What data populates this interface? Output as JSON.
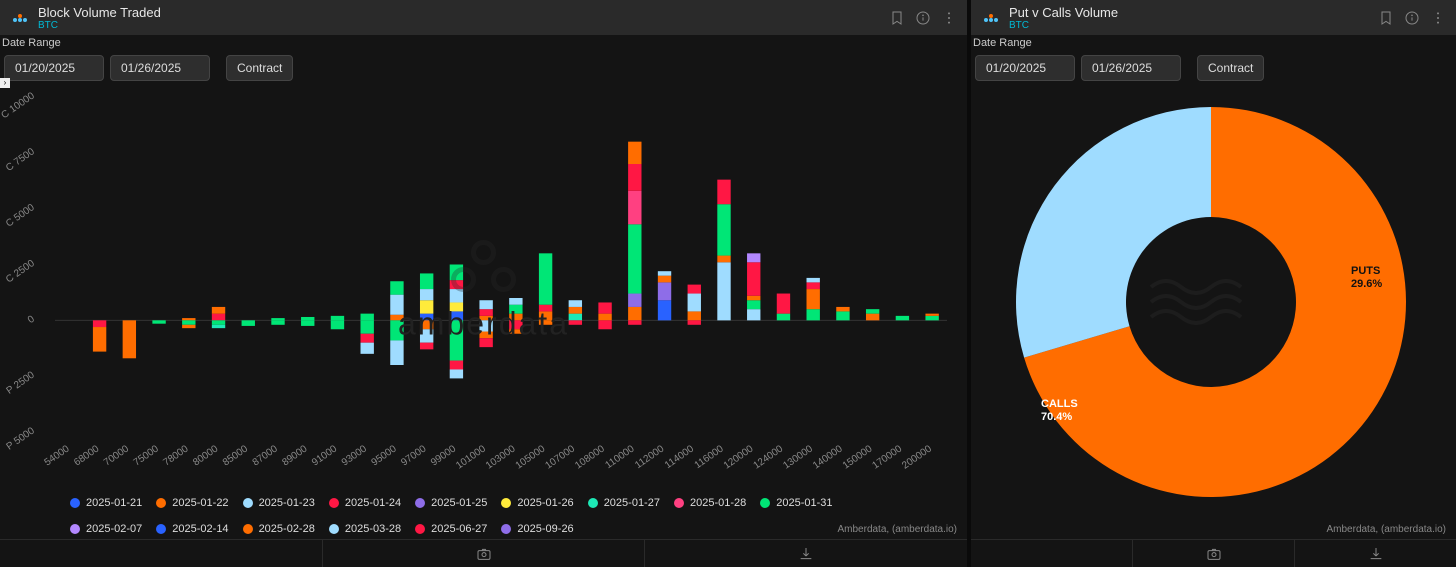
{
  "left": {
    "title": "Block Volume Traded",
    "subtitle": "BTC",
    "date_range_label": "Date Range",
    "date_from": "01/20/2025",
    "date_to": "01/26/2025",
    "contract_btn": "Contract",
    "attribution": "Amberdata, (amberdata.io)",
    "watermark": "amberdata"
  },
  "right": {
    "title": "Put v Calls Volume",
    "subtitle": "BTC",
    "date_range_label": "Date Range",
    "date_from": "01/20/2025",
    "date_to": "01/26/2025",
    "contract_btn": "Contract",
    "attribution": "Amberdata, (amberdata.io)"
  },
  "legend_items": [
    {
      "label": "2025-01-21",
      "color": "#2962ff"
    },
    {
      "label": "2025-01-22",
      "color": "#ff6d00"
    },
    {
      "label": "2025-01-23",
      "color": "#9fdcff"
    },
    {
      "label": "2025-01-24",
      "color": "#ff1744"
    },
    {
      "label": "2025-01-25",
      "color": "#8e6de8"
    },
    {
      "label": "2025-01-26",
      "color": "#ffeb3b"
    },
    {
      "label": "2025-01-27",
      "color": "#1de9b6"
    },
    {
      "label": "2025-01-28",
      "color": "#ff4081"
    },
    {
      "label": "2025-01-31",
      "color": "#00e676"
    },
    {
      "label": "2025-02-07",
      "color": "#b388ff"
    },
    {
      "label": "2025-02-14",
      "color": "#2962ff"
    },
    {
      "label": "2025-02-28",
      "color": "#ff6d00"
    },
    {
      "label": "2025-03-28",
      "color": "#9fdcff"
    },
    {
      "label": "2025-06-27",
      "color": "#ff1744"
    },
    {
      "label": "2025-09-26",
      "color": "#8e6de8"
    }
  ],
  "chart_data": [
    {
      "type": "bar",
      "title": "Block Volume Traded (BTC)",
      "orientation": "diverging",
      "ylabel_pos": "C",
      "ylabel_neg": "P",
      "ylim": [
        -5000,
        10000
      ],
      "y_ticks": [
        -5000,
        -2500,
        0,
        2500,
        5000,
        7500,
        10000
      ],
      "y_tick_labels": [
        "P 5000",
        "P 2500",
        "0",
        "C 2500",
        "C 5000",
        "C 7500",
        "C 10000"
      ],
      "categories": [
        "54000",
        "68000",
        "70000",
        "75000",
        "78000",
        "80000",
        "85000",
        "87000",
        "89000",
        "91000",
        "93000",
        "95000",
        "97000",
        "99000",
        "101000",
        "103000",
        "105000",
        "107000",
        "108000",
        "110000",
        "112000",
        "114000",
        "116000",
        "120000",
        "124000",
        "130000",
        "140000",
        "150000",
        "170000",
        "200000"
      ],
      "series_colors": {
        "2025-01-21": "#2962ff",
        "2025-01-22": "#ff6d00",
        "2025-01-23": "#9fdcff",
        "2025-01-24": "#ff1744",
        "2025-01-25": "#8e6de8",
        "2025-01-26": "#ffeb3b",
        "2025-01-27": "#1de9b6",
        "2025-01-28": "#ff4081",
        "2025-01-31": "#00e676",
        "2025-02-07": "#b388ff",
        "2025-02-14": "#2962ff",
        "2025-02-28": "#ff6d00",
        "2025-03-28": "#9fdcff",
        "2025-06-27": "#ff1744",
        "2025-09-26": "#8e6de8"
      },
      "stacks": [
        {
          "x": "54000",
          "calls": [],
          "puts": []
        },
        {
          "x": "68000",
          "calls": [],
          "puts": [
            {
              "s": "2025-01-24",
              "v": 300
            },
            {
              "s": "2025-01-22",
              "v": 1100
            }
          ]
        },
        {
          "x": "70000",
          "calls": [],
          "puts": [
            {
              "s": "2025-01-22",
              "v": 1700
            }
          ]
        },
        {
          "x": "75000",
          "calls": [],
          "puts": [
            {
              "s": "2025-01-31",
              "v": 150
            }
          ]
        },
        {
          "x": "78000",
          "calls": [
            {
              "s": "2025-01-22",
              "v": 100
            }
          ],
          "puts": [
            {
              "s": "2025-01-31",
              "v": 200
            },
            {
              "s": "2025-01-22",
              "v": 150
            }
          ]
        },
        {
          "x": "80000",
          "calls": [
            {
              "s": "2025-01-24",
              "v": 300
            },
            {
              "s": "2025-01-22",
              "v": 300
            }
          ],
          "puts": [
            {
              "s": "2025-01-31",
              "v": 200
            },
            {
              "s": "2025-01-27",
              "v": 150
            }
          ]
        },
        {
          "x": "85000",
          "calls": [],
          "puts": [
            {
              "s": "2025-01-31",
              "v": 250
            }
          ]
        },
        {
          "x": "87000",
          "calls": [
            {
              "s": "2025-01-31",
              "v": 100
            }
          ],
          "puts": [
            {
              "s": "2025-01-31",
              "v": 200
            }
          ]
        },
        {
          "x": "89000",
          "calls": [
            {
              "s": "2025-01-31",
              "v": 150
            }
          ],
          "puts": [
            {
              "s": "2025-01-31",
              "v": 250
            }
          ]
        },
        {
          "x": "91000",
          "calls": [
            {
              "s": "2025-01-31",
              "v": 200
            }
          ],
          "puts": [
            {
              "s": "2025-01-31",
              "v": 400
            }
          ]
        },
        {
          "x": "93000",
          "calls": [
            {
              "s": "2025-01-31",
              "v": 300
            }
          ],
          "puts": [
            {
              "s": "2025-01-31",
              "v": 600
            },
            {
              "s": "2025-01-24",
              "v": 400
            },
            {
              "s": "2025-01-23",
              "v": 500
            }
          ]
        },
        {
          "x": "95000",
          "calls": [
            {
              "s": "2025-01-22",
              "v": 250
            },
            {
              "s": "2025-01-23",
              "v": 900
            },
            {
              "s": "2025-01-31",
              "v": 600
            }
          ],
          "puts": [
            {
              "s": "2025-01-31",
              "v": 900
            },
            {
              "s": "2025-01-23",
              "v": 1100
            }
          ]
        },
        {
          "x": "97000",
          "calls": [
            {
              "s": "2025-01-21",
              "v": 300
            },
            {
              "s": "2025-01-26",
              "v": 600
            },
            {
              "s": "2025-01-23",
              "v": 500
            },
            {
              "s": "2025-01-31",
              "v": 700
            }
          ],
          "puts": [
            {
              "s": "2025-01-22",
              "v": 400
            },
            {
              "s": "2025-01-23",
              "v": 600
            },
            {
              "s": "2025-01-24",
              "v": 300
            }
          ]
        },
        {
          "x": "99000",
          "calls": [
            {
              "s": "2025-01-21",
              "v": 400
            },
            {
              "s": "2025-01-26",
              "v": 400
            },
            {
              "s": "2025-01-23",
              "v": 600
            },
            {
              "s": "2025-01-24",
              "v": 400
            },
            {
              "s": "2025-01-31",
              "v": 700
            }
          ],
          "puts": [
            {
              "s": "2025-01-31",
              "v": 1800
            },
            {
              "s": "2025-01-24",
              "v": 400
            },
            {
              "s": "2025-01-23",
              "v": 400
            }
          ]
        },
        {
          "x": "101000",
          "calls": [
            {
              "s": "2025-01-22",
              "v": 200
            },
            {
              "s": "2025-01-24",
              "v": 300
            },
            {
              "s": "2025-01-23",
              "v": 400
            }
          ],
          "puts": [
            {
              "s": "2025-01-23",
              "v": 500
            },
            {
              "s": "2025-01-22",
              "v": 300
            },
            {
              "s": "2025-01-24",
              "v": 400
            }
          ]
        },
        {
          "x": "103000",
          "calls": [
            {
              "s": "2025-01-22",
              "v": 300
            },
            {
              "s": "2025-01-31",
              "v": 400
            },
            {
              "s": "2025-01-23",
              "v": 300
            }
          ],
          "puts": [
            {
              "s": "2025-01-24",
              "v": 400
            },
            {
              "s": "2025-01-22",
              "v": 200
            }
          ]
        },
        {
          "x": "105000",
          "calls": [
            {
              "s": "2025-01-22",
              "v": 400
            },
            {
              "s": "2025-01-24",
              "v": 300
            },
            {
              "s": "2025-01-31",
              "v": 2300
            }
          ],
          "puts": [
            {
              "s": "2025-01-22",
              "v": 200
            }
          ]
        },
        {
          "x": "107000",
          "calls": [
            {
              "s": "2025-01-27",
              "v": 300
            },
            {
              "s": "2025-01-22",
              "v": 300
            },
            {
              "s": "2025-01-23",
              "v": 300
            }
          ],
          "puts": [
            {
              "s": "2025-01-24",
              "v": 200
            }
          ]
        },
        {
          "x": "108000",
          "calls": [
            {
              "s": "2025-01-22",
              "v": 300
            },
            {
              "s": "2025-01-24",
              "v": 500
            }
          ],
          "puts": [
            {
              "s": "2025-01-24",
              "v": 400
            }
          ]
        },
        {
          "x": "110000",
          "calls": [
            {
              "s": "2025-01-22",
              "v": 600
            },
            {
              "s": "2025-01-25",
              "v": 600
            },
            {
              "s": "2025-01-31",
              "v": 3100
            },
            {
              "s": "2025-01-28",
              "v": 1500
            },
            {
              "s": "2025-01-24",
              "v": 1200
            },
            {
              "s": "2025-02-28",
              "v": 1000
            }
          ],
          "puts": [
            {
              "s": "2025-01-24",
              "v": 200
            }
          ]
        },
        {
          "x": "112000",
          "calls": [
            {
              "s": "2025-01-21",
              "v": 900
            },
            {
              "s": "2025-01-25",
              "v": 800
            },
            {
              "s": "2025-01-22",
              "v": 300
            },
            {
              "s": "2025-01-23",
              "v": 200
            }
          ],
          "puts": []
        },
        {
          "x": "114000",
          "calls": [
            {
              "s": "2025-01-22",
              "v": 400
            },
            {
              "s": "2025-01-23",
              "v": 800
            },
            {
              "s": "2025-01-24",
              "v": 400
            }
          ],
          "puts": [
            {
              "s": "2025-01-24",
              "v": 200
            }
          ]
        },
        {
          "x": "116000",
          "calls": [
            {
              "s": "2025-01-23",
              "v": 2600
            },
            {
              "s": "2025-01-22",
              "v": 300
            },
            {
              "s": "2025-01-31",
              "v": 2300
            },
            {
              "s": "2025-01-24",
              "v": 1100
            }
          ],
          "puts": []
        },
        {
          "x": "120000",
          "calls": [
            {
              "s": "2025-01-23",
              "v": 500
            },
            {
              "s": "2025-01-31",
              "v": 400
            },
            {
              "s": "2025-01-22",
              "v": 200
            },
            {
              "s": "2025-01-24",
              "v": 1500
            },
            {
              "s": "2025-02-07",
              "v": 400
            }
          ],
          "puts": []
        },
        {
          "x": "124000",
          "calls": [
            {
              "s": "2025-01-31",
              "v": 300
            },
            {
              "s": "2025-01-24",
              "v": 900
            }
          ],
          "puts": []
        },
        {
          "x": "130000",
          "calls": [
            {
              "s": "2025-01-31",
              "v": 500
            },
            {
              "s": "2025-01-22",
              "v": 900
            },
            {
              "s": "2025-01-24",
              "v": 300
            },
            {
              "s": "2025-01-23",
              "v": 200
            }
          ],
          "puts": []
        },
        {
          "x": "140000",
          "calls": [
            {
              "s": "2025-01-31",
              "v": 400
            },
            {
              "s": "2025-01-22",
              "v": 200
            }
          ],
          "puts": []
        },
        {
          "x": "150000",
          "calls": [
            {
              "s": "2025-01-22",
              "v": 300
            },
            {
              "s": "2025-01-31",
              "v": 200
            }
          ],
          "puts": []
        },
        {
          "x": "170000",
          "calls": [
            {
              "s": "2025-01-31",
              "v": 200
            }
          ],
          "puts": []
        },
        {
          "x": "200000",
          "calls": [
            {
              "s": "2025-01-31",
              "v": 200
            },
            {
              "s": "2025-01-22",
              "v": 100
            }
          ],
          "puts": []
        }
      ]
    },
    {
      "type": "pie",
      "donut": true,
      "title": "Put v Calls Volume (BTC)",
      "slices": [
        {
          "name": "CALLS",
          "value": 70.4,
          "label": "CALLS",
          "pct_label": "70.4%",
          "color": "#ff6d00"
        },
        {
          "name": "PUTS",
          "value": 29.6,
          "label": "PUTS",
          "pct_label": "29.6%",
          "color": "#9fdcff"
        }
      ]
    }
  ]
}
